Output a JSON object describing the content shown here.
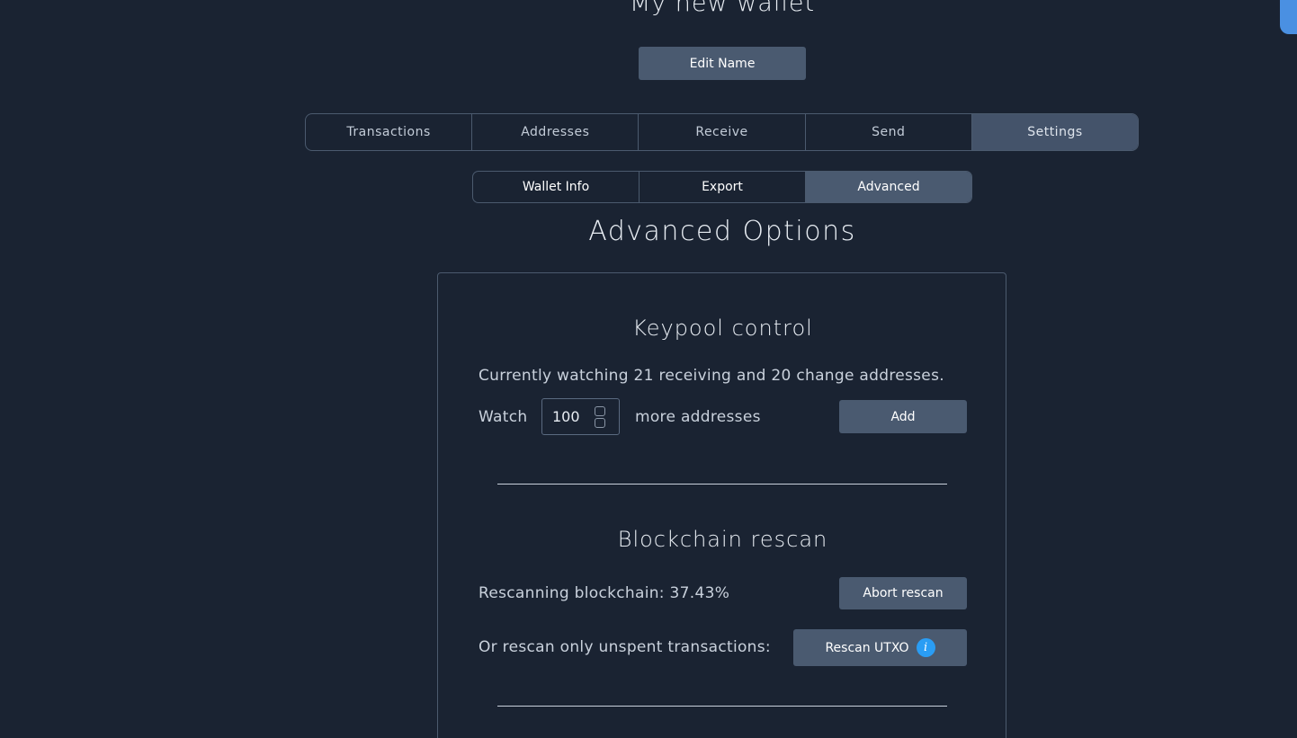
{
  "wallet": {
    "name": "My new wallet",
    "edit_name_label": "Edit Name"
  },
  "main_tabs": [
    {
      "label": "Transactions",
      "active": false
    },
    {
      "label": "Addresses",
      "active": false
    },
    {
      "label": "Receive",
      "active": false
    },
    {
      "label": "Send",
      "active": false
    },
    {
      "label": "Settings",
      "active": true
    }
  ],
  "sub_tabs": [
    {
      "label": "Wallet Info",
      "active": false
    },
    {
      "label": "Export",
      "active": false
    },
    {
      "label": "Advanced",
      "active": true
    }
  ],
  "section_title": "Advanced Options",
  "keypool": {
    "heading": "Keypool control",
    "status": "Currently watching 21 receiving and 20 change addresses.",
    "watch_label": "Watch",
    "watch_value": "100",
    "more_label": "more addresses",
    "add_label": "Add"
  },
  "rescan": {
    "heading": "Blockchain rescan",
    "progress_text": "Rescanning blockchain: 37.43%",
    "abort_label": "Abort rescan",
    "utxo_text": "Or rescan only unspent transactions:",
    "utxo_button_label": "Rescan UTXO",
    "info_icon_glyph": "i"
  },
  "colors": {
    "background": "#1a2332",
    "button": "#4a5a70",
    "accent": "#2a9df4",
    "corner_tab": "#4a90e2"
  }
}
